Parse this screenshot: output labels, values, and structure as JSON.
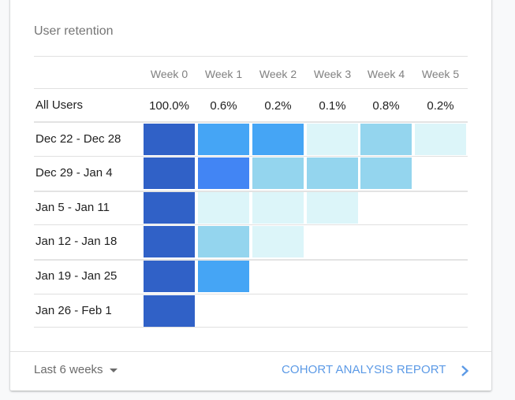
{
  "card": {
    "title": "User retention"
  },
  "chart_data": {
    "type": "heatmap",
    "title": "User retention",
    "columns": [
      "Week 0",
      "Week 1",
      "Week 2",
      "Week 3",
      "Week 4",
      "Week 5"
    ],
    "summary_row": {
      "label": "All Users",
      "values": [
        "100.0%",
        "0.6%",
        "0.2%",
        "0.1%",
        "0.8%",
        "0.2%"
      ]
    },
    "rows": [
      {
        "label": "Dec 22 - Dec 28",
        "levels": [
          5,
          3,
          3,
          1,
          2,
          1
        ]
      },
      {
        "label": "Dec 29 - Jan 4",
        "levels": [
          5,
          4,
          2,
          2,
          2
        ]
      },
      {
        "label": "Jan 5 - Jan 11",
        "levels": [
          5,
          1,
          1,
          1
        ]
      },
      {
        "label": "Jan 12 - Jan 18",
        "levels": [
          5,
          2,
          1
        ]
      },
      {
        "label": "Jan 19 - Jan 25",
        "levels": [
          5,
          3
        ]
      },
      {
        "label": "Jan 26 - Feb 1",
        "levels": [
          5
        ]
      }
    ],
    "level_colors": {
      "1": "#dcf5f9",
      "2": "#94d5ee",
      "3": "#45a5f5",
      "4": "#4285f4",
      "5": "#3061c7"
    }
  },
  "footer": {
    "range_label": "Last 6 weeks",
    "report_link": "COHORT ANALYSIS REPORT"
  }
}
